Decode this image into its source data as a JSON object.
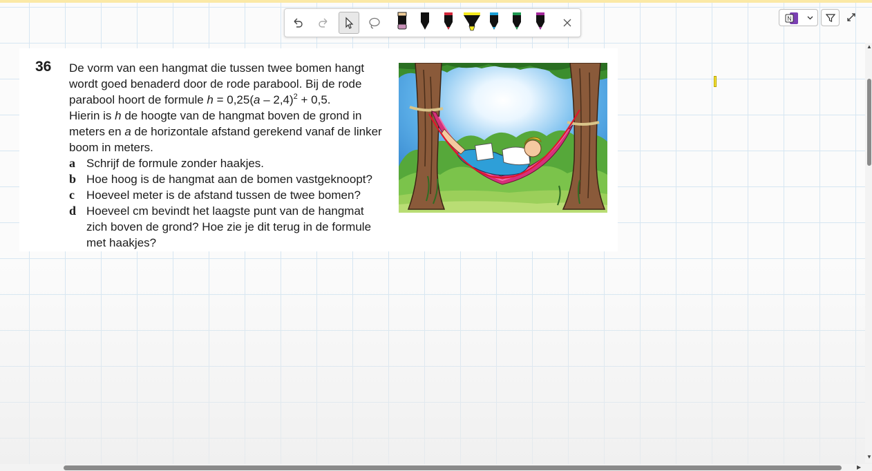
{
  "toolbar": {
    "tools": [
      {
        "name": "undo",
        "icon": "undo-icon"
      },
      {
        "name": "redo",
        "icon": "redo-icon"
      },
      {
        "name": "select",
        "icon": "cursor-icon",
        "selected": true
      },
      {
        "name": "lasso",
        "icon": "lasso-icon"
      }
    ],
    "pens": [
      {
        "name": "eraser",
        "color": "#c890b8",
        "cap": "#f2cf9a"
      },
      {
        "name": "pen-black",
        "color": "#111111"
      },
      {
        "name": "pen-red",
        "color": "#d4273a"
      },
      {
        "name": "highlighter-yellow",
        "color": "#f5ea20"
      },
      {
        "name": "pen-blue",
        "color": "#1aa0d8"
      },
      {
        "name": "pen-green",
        "color": "#1f9a52"
      },
      {
        "name": "pen-purple",
        "color": "#a3289b"
      }
    ],
    "close_icon": "close-icon"
  },
  "controls": {
    "app_icon": "onenote-icon",
    "dropdown_icon": "chevron-down-icon",
    "filter_icon": "funnel-icon",
    "expand_icon": "expand-icon"
  },
  "exercise": {
    "number": "36",
    "line1": "De vorm van een hangmat die tussen twee bomen hangt",
    "line2": "wordt goed benaderd door de rode parabool. Bij de rode",
    "line3_before": "parabool hoort de formule ",
    "line3_h": "h",
    "line3_mid": " = 0,25(",
    "line3_a": "a",
    "line3_after": " – 2,4)",
    "line3_exp": "2",
    "line3_end": " + 0,5.",
    "line4_before": "Hierin is ",
    "line4_h": "h",
    "line4_after": " de hoogte van de hangmat boven de grond in",
    "line5_before": "meters en ",
    "line5_a": "a",
    "line5_after": " de horizontale afstand gerekend vanaf de linker",
    "line6": "boom in meters.",
    "subquestions": [
      {
        "letter": "a",
        "text": "Schrijf de formule zonder haakjes."
      },
      {
        "letter": "b",
        "text": "Hoe hoog is de hangmat aan de bomen vastgeknoopt?"
      },
      {
        "letter": "c",
        "text": "Hoeveel meter is de afstand tussen de twee bomen?"
      },
      {
        "letter": "d",
        "text": "Hoeveel cm bevindt het laagste punt van de hangmat zich boven de grond? Hoe zie je dit terug in de formule met haakjes?"
      }
    ]
  },
  "colors": {
    "accent_bar": "#fbe9a6",
    "parabola": "#e0162b",
    "hammock": "#d6307a"
  }
}
